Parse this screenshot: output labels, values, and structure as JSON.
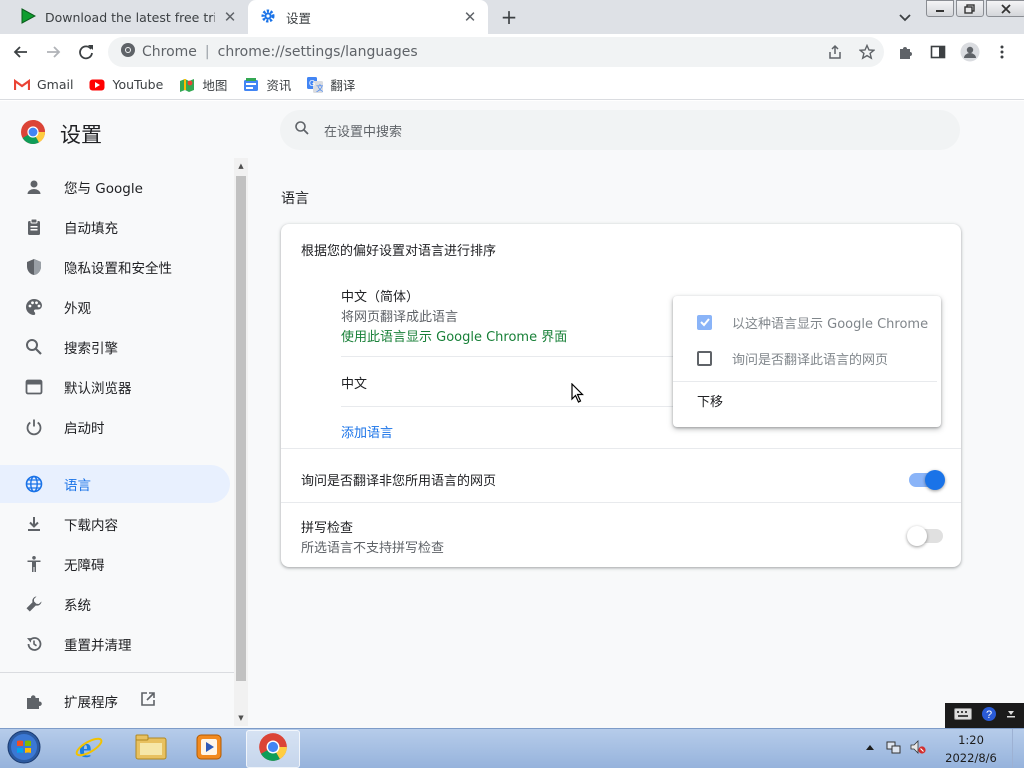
{
  "browser": {
    "tabs": [
      {
        "title": "Download the latest free trial ve",
        "icon": "play-triangle-icon"
      },
      {
        "title": "设置",
        "icon": "settings-gear-icon"
      }
    ],
    "omnibox": {
      "site": "Chrome",
      "separator": "|",
      "url": "chrome://settings/languages"
    },
    "bookmarks": [
      {
        "label": "Gmail",
        "icon": "gmail-icon"
      },
      {
        "label": "YouTube",
        "icon": "youtube-icon"
      },
      {
        "label": "地图",
        "icon": "maps-icon"
      },
      {
        "label": "资讯",
        "icon": "news-icon"
      },
      {
        "label": "翻译",
        "icon": "translate-icon"
      }
    ]
  },
  "settings": {
    "title": "设置",
    "search_placeholder": "在设置中搜索",
    "nav": [
      {
        "label": "您与 Google",
        "icon": "person-icon"
      },
      {
        "label": "自动填充",
        "icon": "clipboard-icon"
      },
      {
        "label": "隐私设置和安全性",
        "icon": "shield-icon"
      },
      {
        "label": "外观",
        "icon": "palette-icon"
      },
      {
        "label": "搜索引擎",
        "icon": "search-icon"
      },
      {
        "label": "默认浏览器",
        "icon": "browser-window-icon"
      },
      {
        "label": "启动时",
        "icon": "power-icon"
      },
      {
        "label": "语言",
        "icon": "globe-icon"
      },
      {
        "label": "下载内容",
        "icon": "download-icon"
      },
      {
        "label": "无障碍",
        "icon": "accessibility-icon"
      },
      {
        "label": "系统",
        "icon": "wrench-icon"
      },
      {
        "label": "重置并清理",
        "icon": "history-icon"
      },
      {
        "label": "扩展程序",
        "icon": "puzzle-icon"
      }
    ],
    "active_nav": "语言",
    "section_title": "语言",
    "card": {
      "order_heading": "根据您的偏好设置对语言进行排序",
      "languages": [
        {
          "name": "中文（简体）",
          "line1": "将网页翻译成此语言",
          "line2": "使用此语言显示 Google Chrome 界面"
        },
        {
          "name": "中文"
        }
      ],
      "add_language": "添加语言",
      "offer_translate": {
        "label": "询问是否翻译非您所用语言的网页",
        "on": true
      },
      "spellcheck": {
        "label": "拼写检查",
        "sub": "所选语言不支持拼写检查",
        "on": false
      }
    },
    "menu": {
      "items": [
        {
          "label": "以这种语言显示 Google Chrome",
          "checked": true,
          "disabled": true
        },
        {
          "label": "询问是否翻译此语言的网页",
          "checked": false,
          "disabled": true
        },
        {
          "label": "下移"
        }
      ]
    }
  },
  "taskbar": {
    "apps": [
      "start-orb-icon",
      "internet-explorer-icon",
      "file-explorer-icon",
      "media-player-icon",
      "chrome-icon"
    ],
    "clock": {
      "time": "1:20",
      "date": "2022/8/6"
    }
  },
  "colors": {
    "accent": "#1a73e8",
    "link_green": "#188038",
    "active_nav_bg": "#e8f0fe",
    "tab_strip": "#dee1e6"
  }
}
